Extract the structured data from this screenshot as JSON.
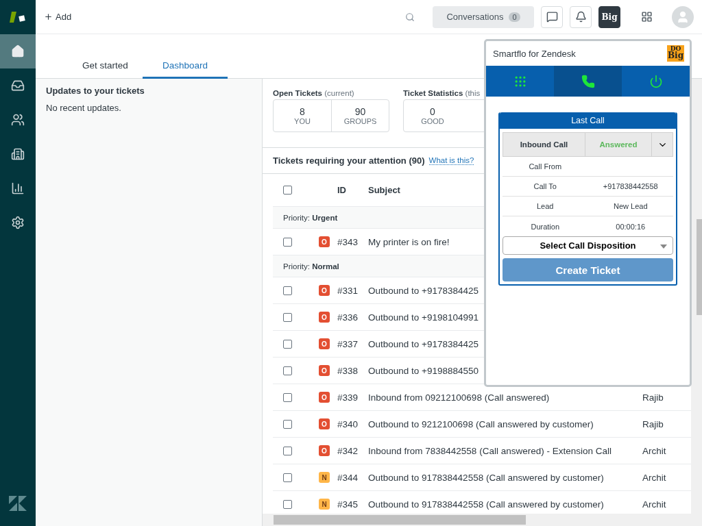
{
  "sidebar": {
    "nav": [
      {
        "kind": "home",
        "selected": true
      },
      {
        "kind": "views",
        "selected": false
      },
      {
        "kind": "customers",
        "selected": false
      },
      {
        "kind": "organizations",
        "selected": false
      },
      {
        "kind": "reporting",
        "selected": false
      },
      {
        "kind": "admin",
        "selected": false
      }
    ]
  },
  "top_bar": {
    "add_label": "Add",
    "conversations": {
      "label": "Conversations",
      "count": "0"
    },
    "app_button": {
      "label": "Big",
      "selected": true
    }
  },
  "tabs": [
    {
      "label": "Get started",
      "selected": false
    },
    {
      "label": "Dashboard",
      "selected": true
    }
  ],
  "updates": {
    "title": "Updates to your tickets",
    "message": "No recent updates."
  },
  "stats": [
    {
      "title": "Open Tickets",
      "note": "(current)",
      "cells": [
        {
          "value": "8",
          "label": "YOU"
        },
        {
          "value": "90",
          "label": "GROUPS"
        }
      ]
    },
    {
      "title": "Ticket Statistics",
      "note": "(this",
      "cells": [
        {
          "value": "0",
          "label": "GOOD"
        }
      ]
    }
  ],
  "attention": {
    "title": "Tickets requiring your attention (90)",
    "link": "What is this?"
  },
  "table": {
    "columns": [
      "ID",
      "Subject"
    ],
    "all_checked": false,
    "groups": [
      {
        "label": "Priority:",
        "value": "Urgent",
        "rows": [
          {
            "checked": false,
            "status": "O",
            "color": "#e34f32",
            "id": "#343",
            "subject": "My printer is on fire!"
          }
        ]
      },
      {
        "label": "Priority:",
        "value": "Normal",
        "rows": [
          {
            "checked": false,
            "status": "O",
            "color": "#e34f32",
            "id": "#331",
            "subject": "Outbound to +9178384425"
          },
          {
            "checked": false,
            "status": "O",
            "color": "#e34f32",
            "id": "#336",
            "subject": "Outbound to +9198104991"
          },
          {
            "checked": false,
            "status": "O",
            "color": "#e34f32",
            "id": "#337",
            "subject": "Outbound to +9178384425"
          },
          {
            "checked": false,
            "status": "O",
            "color": "#e34f32",
            "id": "#338",
            "subject": "Outbound to +9198884550"
          },
          {
            "checked": false,
            "status": "O",
            "color": "#e34f32",
            "id": "#339",
            "subject": "Inbound from 09212100698 (Call answered)",
            "requester": "Rajib"
          },
          {
            "checked": false,
            "status": "O",
            "color": "#e34f32",
            "id": "#340",
            "subject": "Outbound to 9212100698 (Call answered by customer)",
            "requester": "Rajib"
          },
          {
            "checked": false,
            "status": "O",
            "color": "#e34f32",
            "id": "#342",
            "subject": "Inbound from 7838442558 (Call answered) - Extension Call",
            "requester": "Archit"
          },
          {
            "checked": false,
            "status": "N",
            "color": "#ffb648",
            "id": "#344",
            "subject": "Outbound to 917838442558 (Call answered by customer)",
            "requester": "Archit"
          },
          {
            "checked": false,
            "status": "N",
            "color": "#ffb648",
            "id": "#345",
            "subject": "Outbound to 917838442558 (Call answered by customer)",
            "requester": "Archit"
          }
        ]
      }
    ]
  },
  "popup": {
    "title": "Smartflo for Zendesk",
    "logo": {
      "top": "DO",
      "bottom": "Big"
    },
    "tabs": [
      {
        "kind": "dialpad",
        "selected": false
      },
      {
        "kind": "phone",
        "selected": true
      },
      {
        "kind": "power",
        "selected": false
      }
    ],
    "card": {
      "title": "Last Call",
      "direction": "Inbound Call",
      "status": "Answered",
      "details": [
        {
          "label": "Call From"
        },
        {
          "label": "Call To",
          "value": "+917838442558"
        },
        {
          "label": "Lead",
          "value": "New Lead"
        },
        {
          "label": "Duration",
          "value": "00:00:16"
        }
      ],
      "disposition_placeholder": "Select Call Disposition",
      "button": {
        "label": "Create Ticket",
        "disabled": true
      }
    }
  }
}
